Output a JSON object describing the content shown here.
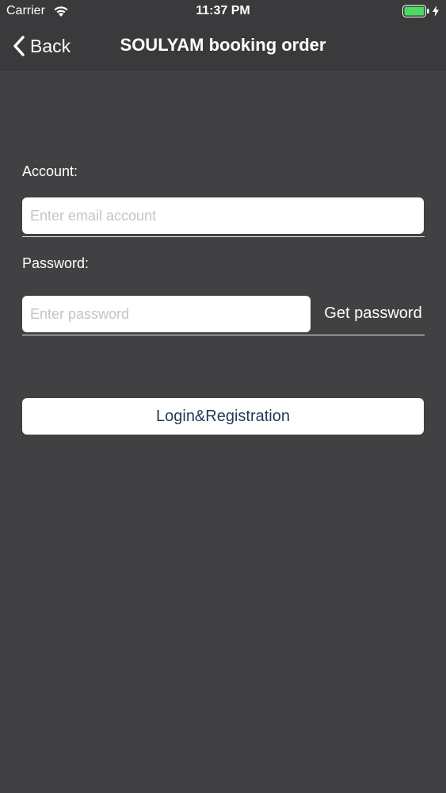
{
  "status_bar": {
    "carrier": "Carrier",
    "time": "11:37 PM",
    "wifi_icon": "wifi-icon",
    "battery_icon": "battery-icon",
    "charging_icon": "charging-bolt-icon",
    "battery_color": "#4cd964"
  },
  "nav": {
    "back_label": "Back",
    "back_icon": "chevron-left-icon",
    "title": "SOULYAM booking order"
  },
  "form": {
    "account_label": "Account:",
    "account_placeholder": "Enter email account",
    "account_value": "",
    "password_label": "Password:",
    "password_placeholder": "Enter password",
    "password_value": "",
    "get_password_label": "Get password",
    "login_label": "Login&Registration"
  },
  "colors": {
    "background": "#414042",
    "bar_background": "#3a393b",
    "login_text": "#1f3a5a"
  }
}
